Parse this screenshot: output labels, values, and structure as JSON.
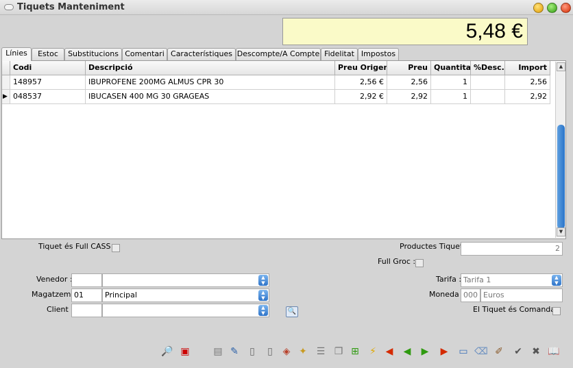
{
  "window": {
    "title": "Tiquets Manteniment"
  },
  "total": {
    "value": "5,48 €"
  },
  "tabs": [
    "Línies",
    "Estoc",
    "Substitucions",
    "Comentari",
    "Característiques",
    "Descompte/A Compte",
    "Fidelitat",
    "Impostos"
  ],
  "grid": {
    "columns": [
      "Codi",
      "Descripció",
      "Preu Origen",
      "Preu",
      "Quantitat",
      "%Desc.",
      "Import"
    ],
    "rows": [
      {
        "codi": "148957",
        "descripcio": "IBUPROFENE 200MG ALMUS CPR 30",
        "preu_origen": "2,56 €",
        "preu": "2,56",
        "quantitat": "1",
        "desc": "",
        "import": "2,56"
      },
      {
        "codi": "048537",
        "descripcio": "IBUCASEN 400 MG 30 GRAGEAS",
        "preu_origen": "2,92 €",
        "preu": "2,92",
        "quantitat": "1",
        "desc": "",
        "import": "2,92"
      }
    ]
  },
  "form": {
    "tiquet_full_cass_label": "Tiquet és Full CASS :",
    "productes_tiquet_label": "Productes Tiquet :",
    "productes_tiquet_value": "2",
    "full_groc_label": "Full Groc :",
    "venedor_label": "Venedor :",
    "venedor_code": "",
    "venedor_name": "",
    "magatzem_label": "Magatzem :",
    "magatzem_code": "01",
    "magatzem_name": "Principal",
    "client_label": "Client :",
    "client_code": "",
    "client_name": "",
    "tarifa_label": "Tarifa :",
    "tarifa_value": "Tarifa 1",
    "moneda_label": "Moneda :",
    "moneda_code": "000",
    "moneda_name": "Euros",
    "comanda_label": "El Tiquet és Comanda :"
  },
  "toolbar_icons": [
    "search-doc-icon",
    "pdf-icon",
    "clipboard-icon",
    "edit-doc-icon",
    "page-1-icon",
    "page-2-icon",
    "import-icon",
    "new-doc-icon",
    "list-icon",
    "copy-icon",
    "add-doc-icon",
    "lightning-icon",
    "first-arrow-icon",
    "prev-arrow-icon",
    "next-arrow-icon",
    "last-arrow-icon",
    "blank-doc-icon",
    "eraser-icon",
    "brush-icon",
    "accept-check-icon",
    "cancel-x-icon",
    "book-icon"
  ],
  "colors": {
    "total_bg": "#fafac8",
    "scroll_thumb": "#2a74c9",
    "arrow_red": "#d42a00",
    "arrow_green": "#2f9a10"
  }
}
